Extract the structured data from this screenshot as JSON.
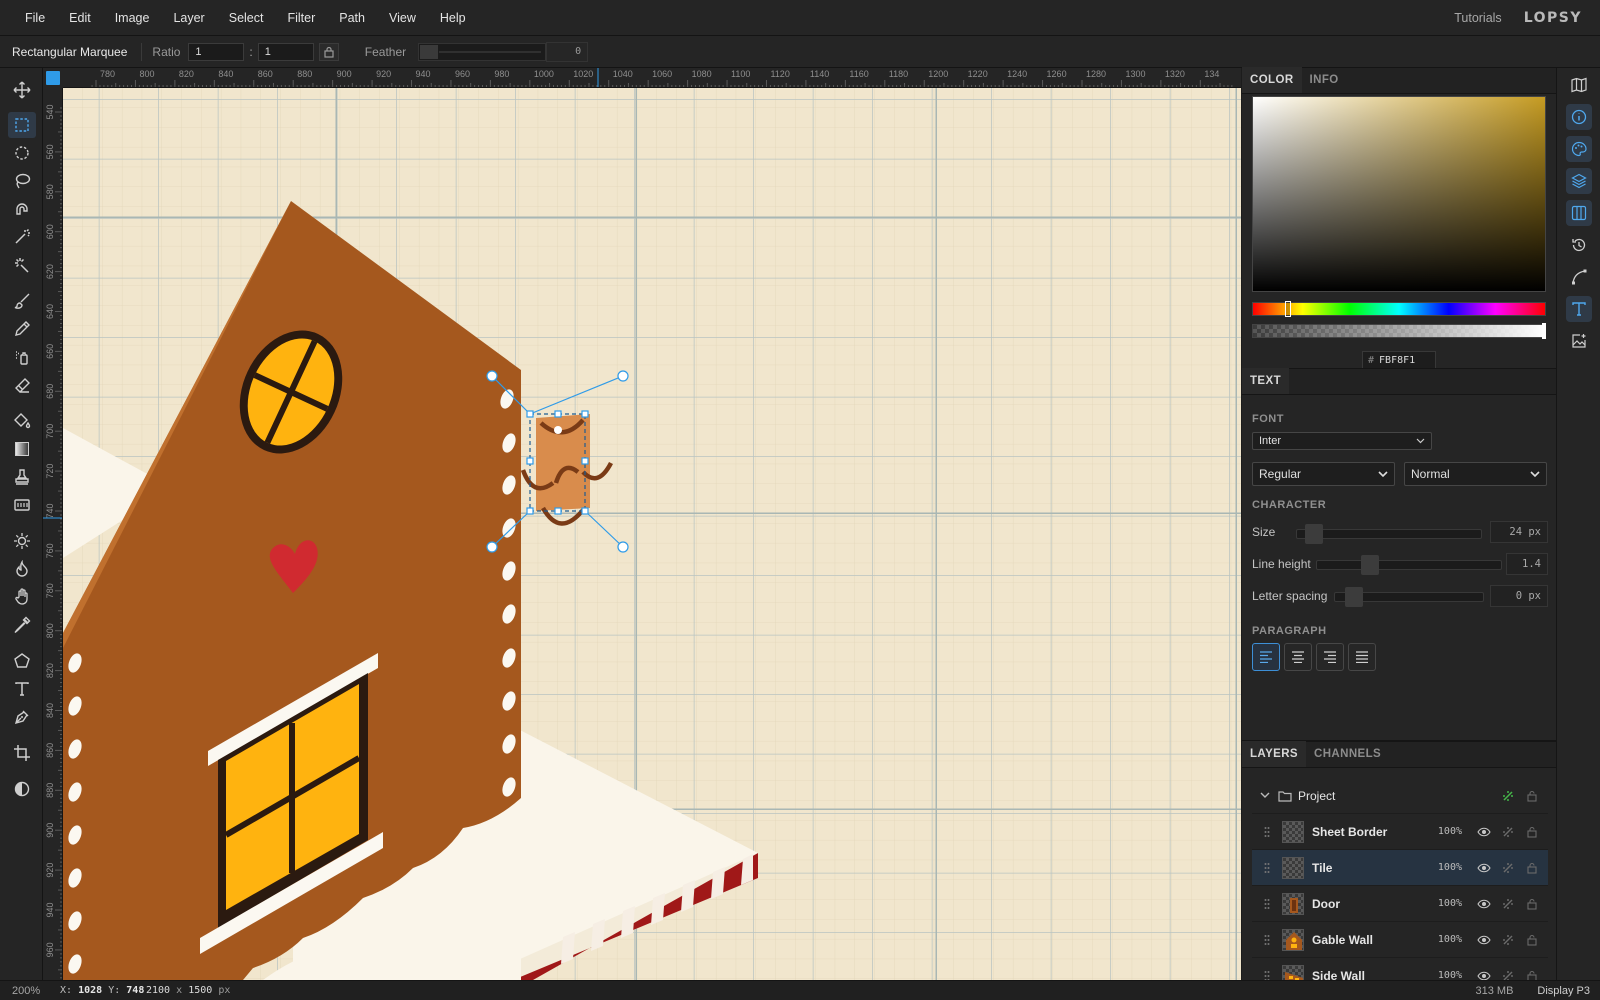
{
  "menubar": {
    "items": [
      "File",
      "Edit",
      "Image",
      "Layer",
      "Select",
      "Filter",
      "Path",
      "View",
      "Help"
    ],
    "tutorials": "Tutorials",
    "logo": "LOPSY"
  },
  "options": {
    "tool_name": "Rectangular Marquee",
    "ratio_label": "Ratio",
    "ratio_w": "1",
    "ratio_h": "1",
    "ratio_sep": ":",
    "feather_label": "Feather",
    "feather_value": "0"
  },
  "tools": [
    "move-icon",
    "rect-marquee-icon",
    "ellipse-marquee-icon",
    "lasso-icon",
    "magnetic-lasso-icon",
    "magic-wand-icon",
    "quick-select-icon",
    "brush-icon",
    "pencil-icon",
    "spray-icon",
    "eraser-icon",
    "bucket-icon",
    "gradient-icon",
    "stamp-icon",
    "pattern-icon",
    "dodge-icon",
    "burn-icon",
    "hand-icon",
    "eyedropper-icon",
    "polygon-icon",
    "text-icon",
    "pen-icon",
    "crop-icon",
    "contrast-icon"
  ],
  "active_tool": "rect-marquee-icon",
  "rulers": {
    "h_ticks": [
      "780",
      "800",
      "820",
      "840",
      "860",
      "880",
      "900",
      "920",
      "940",
      "960",
      "980",
      "1000",
      "1020",
      "1040",
      "1060",
      "1080",
      "1100",
      "1120",
      "1140",
      "1160",
      "1180",
      "1200",
      "1220",
      "1240",
      "1260",
      "1280",
      "1300",
      "1320",
      "134"
    ],
    "v_ticks": [
      "540",
      "560",
      "580",
      "600",
      "620",
      "640",
      "660",
      "680",
      "700",
      "720",
      "740",
      "760",
      "780",
      "800",
      "820",
      "840",
      "860",
      "880",
      "900",
      "920",
      "940",
      "960"
    ]
  },
  "color_panel": {
    "tabs": [
      "COLOR",
      "INFO"
    ],
    "active_tab": "COLOR",
    "hue_color": "#c59b22",
    "hex_prefix": "#",
    "hex_value": "FBF8F1"
  },
  "text_panel": {
    "tab": "TEXT",
    "font_label": "FONT",
    "font_family": "Inter",
    "font_style": "Regular",
    "font_weight": "Normal",
    "character_label": "CHARACTER",
    "size_label": "Size",
    "size_value": "24 px",
    "line_height_label": "Line height",
    "line_height_value": "1.4",
    "letter_spacing_label": "Letter spacing",
    "letter_spacing_value": "0 px",
    "paragraph_label": "PARAGRAPH",
    "alignments": [
      "align-left-icon",
      "align-center-icon",
      "align-right-icon",
      "align-justify-icon"
    ],
    "active_alignment": "align-left-icon"
  },
  "layers_panel": {
    "tabs": [
      "LAYERS",
      "CHANNELS"
    ],
    "active_tab": "LAYERS",
    "group_name": "Project",
    "layers": [
      {
        "name": "Sheet Border",
        "opacity": "100%",
        "selected": false
      },
      {
        "name": "Tile",
        "opacity": "100%",
        "selected": true
      },
      {
        "name": "Door",
        "opacity": "100%",
        "selected": false
      },
      {
        "name": "Gable Wall",
        "opacity": "100%",
        "selected": false
      },
      {
        "name": "Side Wall",
        "opacity": "100%",
        "selected": false
      }
    ]
  },
  "right_rail": [
    "map-icon",
    "info-icon",
    "palette-icon",
    "layers-icon",
    "columns-icon",
    "history-icon",
    "path-icon",
    "text-icon",
    "image-plus-icon"
  ],
  "status": {
    "zoom": "200%",
    "x_label": "X:",
    "x_value": "1028",
    "y_label": "Y:",
    "y_value": "748",
    "doc_width": "2100",
    "doc_sep": "x",
    "doc_height": "1500",
    "doc_unit": "px",
    "memory": "313 MB",
    "profile": "Display P3"
  },
  "colors": {
    "accent": "#2f9be8",
    "canvas_bg": "#f1e6cd",
    "wall_brown": "#a5581e",
    "window_yellow": "#ffb30f",
    "heart_red": "#d02a30",
    "tile_orange": "#d98c4c",
    "frosting": "#fbf8f1"
  }
}
